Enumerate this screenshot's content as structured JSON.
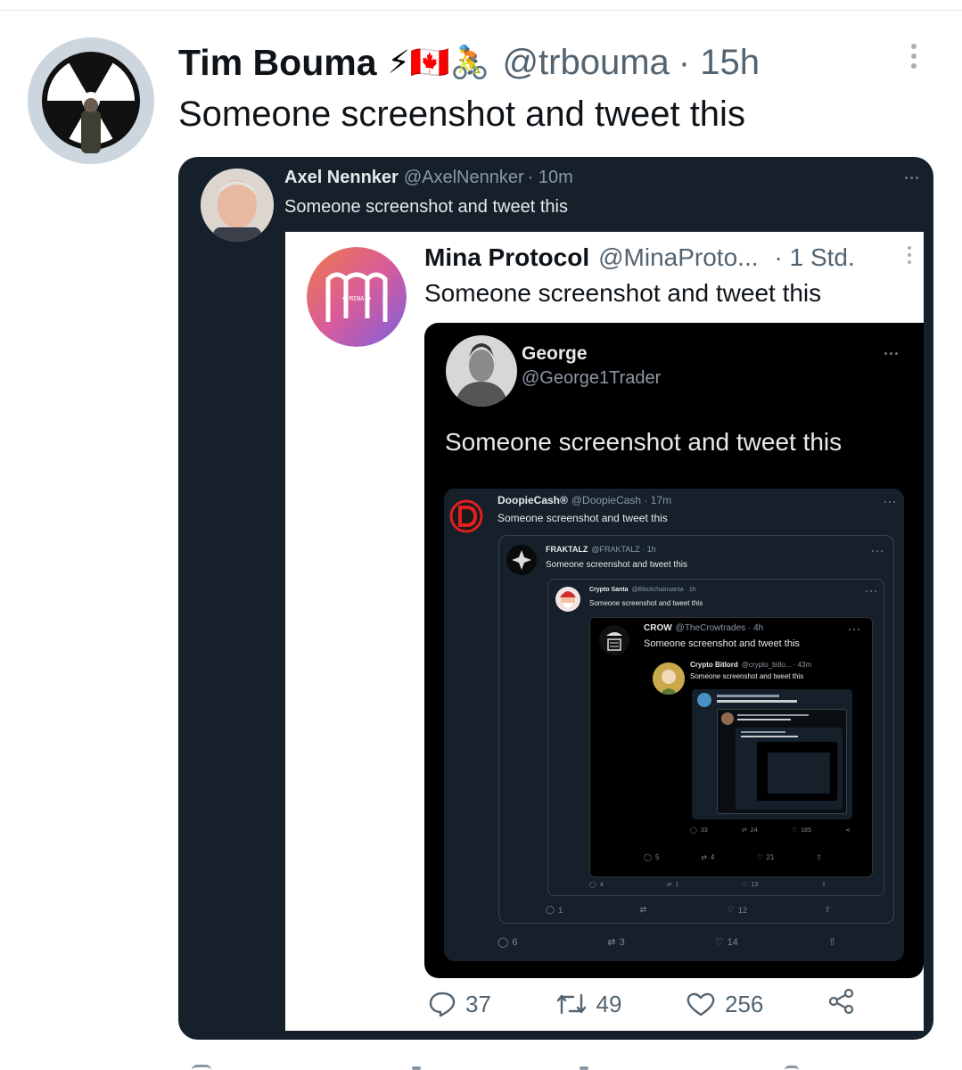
{
  "tweet": {
    "author_name": "Tim Bouma",
    "author_emoji": "⚡🇨🇦🚴",
    "handle": "@trbouma",
    "time": "· 15h",
    "text": "Someone screenshot and tweet this"
  },
  "quote1": {
    "author_name": "Axel Nennker",
    "handle": "@AxelNennker",
    "time": "· 10m",
    "text": "Someone screenshot and tweet this"
  },
  "quote2": {
    "author_name": "Mina Protocol",
    "handle": "@MinaProto...",
    "time": "· 1 Std.",
    "text": "Someone screenshot and tweet this",
    "replies": "37",
    "retweets": "49",
    "likes": "256"
  },
  "quote3": {
    "author_name": "George",
    "handle": "@George1Trader",
    "text": "Someone screenshot and tweet this"
  },
  "quote4": {
    "author_name": "DoopieCash®",
    "handle": "@DoopieCash · 17m",
    "text": "Someone screenshot and tweet this",
    "replies": "6",
    "retweets": "3",
    "likes": "14"
  },
  "quote5": {
    "author_name": "FRAKTALZ",
    "handle": "@FRAKTALZ · 1h",
    "text": "Someone screenshot and tweet this",
    "replies": "1",
    "retweets": "",
    "likes": "12"
  },
  "quote6": {
    "author_name": "Crypto Santa",
    "handle": "@Blockchainsanta · 1h",
    "text": "Someone screenshot and tweet this",
    "replies": "4",
    "retweets": "1",
    "likes": "13"
  },
  "quote7": {
    "author_name": "CROW",
    "handle": "@TheCrowtrades · 4h",
    "text": "Someone screenshot and tweet this",
    "replies": "5",
    "retweets": "4",
    "likes": "21"
  },
  "quote8": {
    "author_name": "Crypto Bitlord",
    "handle": "@crypto_bitlo... · 43m",
    "text": "Someone screenshot and tweet this",
    "replies": "33",
    "retweets": "24",
    "likes": "185"
  },
  "colors": {
    "outer_dark": "#15202b",
    "quote_black": "#000000",
    "nested_dark": "#15202b",
    "border": "#38444d",
    "text_dark": "#0f1419",
    "muted": "#536471"
  }
}
